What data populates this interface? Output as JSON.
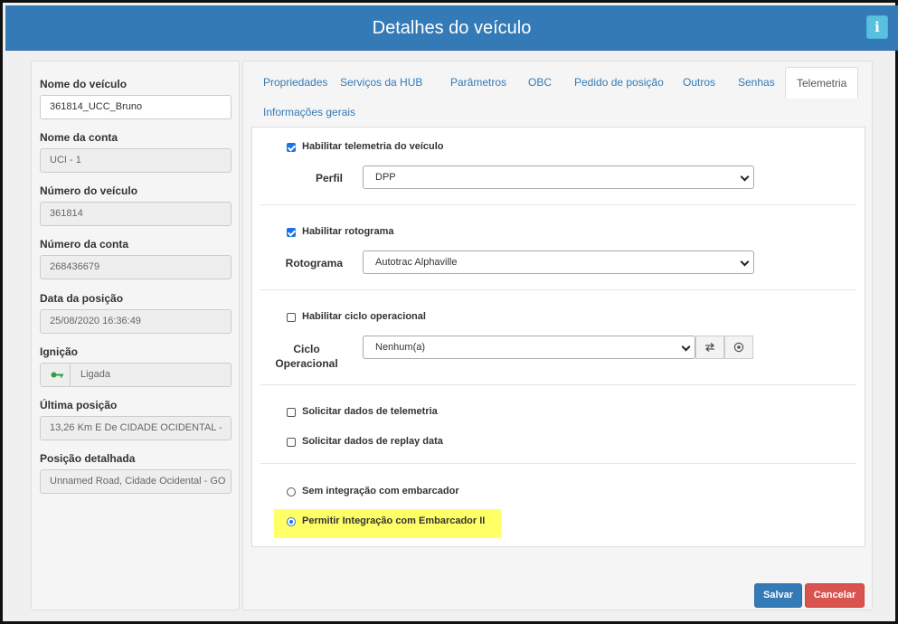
{
  "header": {
    "title": "Detalhes do veículo",
    "info_label": "i"
  },
  "left": {
    "vehicle_name_label": "Nome do veículo",
    "vehicle_name_value": "361814_UCC_Bruno",
    "account_name_label": "Nome da conta",
    "account_name_value": "UCI - 1",
    "vehicle_number_label": "Número do veículo",
    "vehicle_number_value": "361814",
    "account_number_label": "Número da conta",
    "account_number_value": "268436679",
    "position_date_label": "Data da posição",
    "position_date_value": "25/08/2020 16:36:49",
    "ignition_label": "Ignição",
    "ignition_value": "Ligada",
    "ignition_icon": "key-icon",
    "last_position_label": "Última posição",
    "last_position_value": "13,26 Km E De CIDADE OCIDENTAL -",
    "detailed_position_label": "Posição detalhada",
    "detailed_position_value": "Unnamed Road, Cidade Ocidental - GO"
  },
  "tabs": [
    {
      "label": "Propriedades"
    },
    {
      "label": "Serviços da HUB"
    },
    {
      "label": "Parâmetros"
    },
    {
      "label": "OBC"
    },
    {
      "label": "Pedido de posição"
    },
    {
      "label": "Outros"
    },
    {
      "label": "Senhas"
    },
    {
      "label": "Telemetria"
    },
    {
      "label": "Informações gerais"
    }
  ],
  "active_tab": "Telemetria",
  "telemetry": {
    "enable_telemetry_label": "Habilitar telemetria do veículo",
    "enable_telemetry_checked": true,
    "profile_label": "Perfil",
    "profile_value": "DPP",
    "enable_rotogram_label": "Habilitar rotograma",
    "enable_rotogram_checked": true,
    "rotogram_label": "Rotograma",
    "rotogram_value": "Autotrac Alphaville",
    "enable_cycle_label": "Habilitar ciclo operacional",
    "enable_cycle_checked": false,
    "cycle_label_line1": "Ciclo",
    "cycle_label_line2": "Operacional",
    "cycle_value": "Nenhum(a)",
    "request_telemetry_label": "Solicitar dados de telemetria",
    "request_telemetry_checked": false,
    "request_replay_label": "Solicitar dados de replay data",
    "request_replay_checked": false,
    "no_integration_label": "Sem integração com embarcador",
    "allow_integration_label": "Permitir Integração com Embarcador II",
    "selected_integration": "Permitir Integração com Embarcador II",
    "highlight_color": "#ffff66"
  },
  "footer": {
    "save_label": "Salvar",
    "cancel_label": "Cancelar"
  }
}
